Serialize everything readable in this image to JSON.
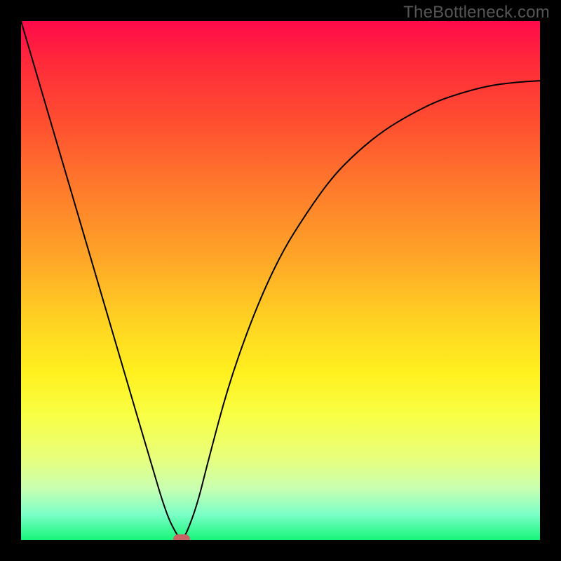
{
  "watermark": "TheBottleneck.com",
  "chart_data": {
    "type": "line",
    "title": "",
    "xlabel": "",
    "ylabel": "",
    "xlim": [
      0,
      1
    ],
    "ylim": [
      0,
      1
    ],
    "series": [
      {
        "name": "bottleneck-curve",
        "x": [
          0.0,
          0.05,
          0.1,
          0.15,
          0.2,
          0.25,
          0.28,
          0.3,
          0.31,
          0.32,
          0.34,
          0.36,
          0.4,
          0.45,
          0.5,
          0.55,
          0.6,
          0.65,
          0.7,
          0.75,
          0.8,
          0.85,
          0.9,
          0.95,
          1.0
        ],
        "y": [
          1.0,
          0.83,
          0.66,
          0.49,
          0.32,
          0.15,
          0.05,
          0.01,
          0.0,
          0.015,
          0.07,
          0.15,
          0.3,
          0.44,
          0.55,
          0.63,
          0.7,
          0.75,
          0.79,
          0.82,
          0.845,
          0.862,
          0.875,
          0.882,
          0.885
        ]
      }
    ],
    "marker": {
      "x": 0.31,
      "y": 0.0
    },
    "gradient_colors": {
      "top": "#ff0a4a",
      "mid_upper": "#ffa728",
      "mid_lower": "#fff120",
      "bottom": "#17f57a"
    },
    "curve_color": "#000000",
    "marker_color": "#c86464"
  }
}
